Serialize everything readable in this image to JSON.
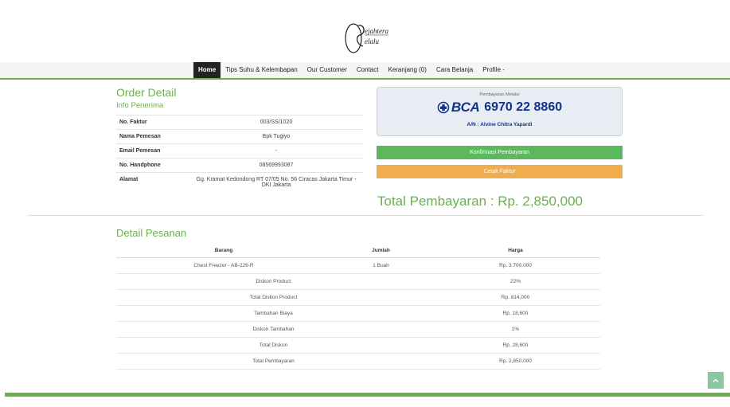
{
  "brand": {
    "logo_text": "Sejahtera Selalu"
  },
  "nav": {
    "items": [
      {
        "label": "Home",
        "active": true
      },
      {
        "label": "Tips Suhu & Kelembapan"
      },
      {
        "label": "Our Customer"
      },
      {
        "label": "Contact"
      },
      {
        "label": "Keranjang (0)"
      },
      {
        "label": "Cara Belanja"
      },
      {
        "label": "Profile -"
      }
    ]
  },
  "order": {
    "title": "Order Detail",
    "subtitle": "Info Penerima",
    "fields": [
      {
        "key": "No. Faktur",
        "value": "003/SS/1020"
      },
      {
        "key": "Nama Pemesan",
        "value": "Bpk Tugiyo"
      },
      {
        "key": "Email Pemesan",
        "value": "-"
      },
      {
        "key": "No. Handphone",
        "value": "08569993087"
      },
      {
        "key": "Alamat",
        "value": "Gg. Kramat Kedondong RT 07/05 No. 56 Ciracas Jakarta Timur - DKI Jakarta"
      }
    ]
  },
  "payment": {
    "via_label": "Pembayaran Melalui",
    "bank": "BCA",
    "account_number": "6970 22 8860",
    "account_name": "A/N : Alvine Chitra Yapardi",
    "confirm_button": "Konfirmasi Pembayaran",
    "print_button": "Cetak Faktur",
    "total_label": "Total Pembayaran : Rp. 2,850,000"
  },
  "detail": {
    "title": "Detail Pesanan",
    "headers": [
      "Barang",
      "Jumlah",
      "Harga"
    ],
    "item": {
      "name": "Chest Freezer - AB-226-R",
      "qty": "1 Buah",
      "price": "Rp. 3.700.000"
    },
    "summary": [
      {
        "label": "Diskon Product",
        "value": "22%"
      },
      {
        "label": "Total Diskon Product",
        "value": "Rp. 814,000"
      },
      {
        "label": "Tambahan Biaya",
        "value": "Rp. 18,600"
      },
      {
        "label": "Diskon Tambahan",
        "value": "1%"
      },
      {
        "label": "Total Diskon",
        "value": "Rp. 28,600"
      },
      {
        "label": "Total Pembayaran",
        "value": "Rp. 2,850,000"
      }
    ]
  },
  "icons": {
    "scroll_top": "chevron-up-icon",
    "bca": "bca-logo-icon"
  },
  "colors": {
    "accent": "#6ab04c",
    "confirm": "#5cb85c",
    "print": "#f0ad4e",
    "bank": "#13328a"
  }
}
